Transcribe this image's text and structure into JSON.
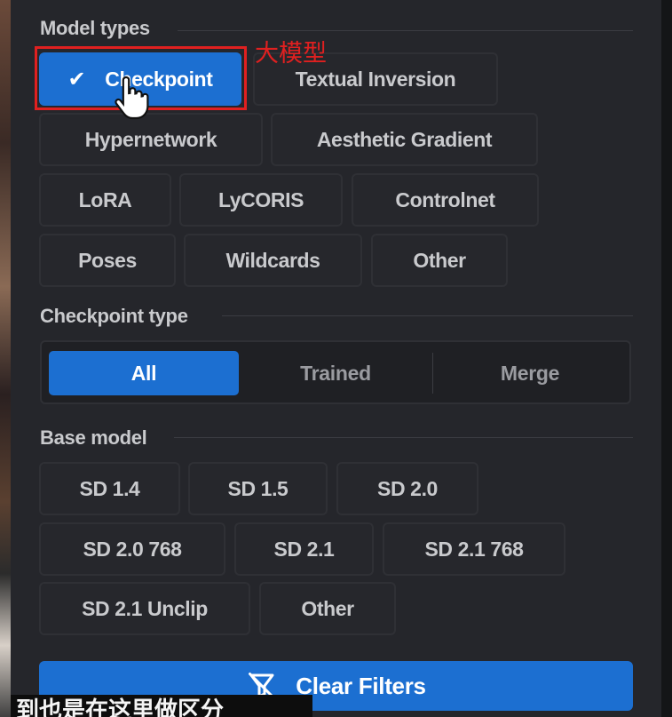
{
  "sections": {
    "model_types": {
      "title": "Model types",
      "items": [
        {
          "label": "Checkpoint",
          "selected": true
        },
        {
          "label": "Textual Inversion"
        },
        {
          "label": "Hypernetwork"
        },
        {
          "label": "Aesthetic Gradient"
        },
        {
          "label": "LoRA"
        },
        {
          "label": "LyCORIS"
        },
        {
          "label": "Controlnet"
        },
        {
          "label": "Poses"
        },
        {
          "label": "Wildcards"
        },
        {
          "label": "Other"
        }
      ]
    },
    "checkpoint_type": {
      "title": "Checkpoint type",
      "options": [
        {
          "label": "All",
          "selected": true
        },
        {
          "label": "Trained"
        },
        {
          "label": "Merge"
        }
      ]
    },
    "base_model": {
      "title": "Base model",
      "items": [
        {
          "label": "SD 1.4"
        },
        {
          "label": "SD 1.5"
        },
        {
          "label": "SD 2.0"
        },
        {
          "label": "SD 2.0 768"
        },
        {
          "label": "SD 2.1"
        },
        {
          "label": "SD 2.1 768"
        },
        {
          "label": "SD 2.1 Unclip"
        },
        {
          "label": "Other"
        }
      ]
    }
  },
  "clear_filters": {
    "label": "Clear Filters",
    "icon": "filter-off-icon"
  },
  "annotation": {
    "text": "大模型"
  },
  "subtitle": {
    "text": "到也是在这里做区分"
  },
  "colors": {
    "accent": "#1c6fd1",
    "highlight": "#e02020",
    "panel": "#25262b"
  }
}
